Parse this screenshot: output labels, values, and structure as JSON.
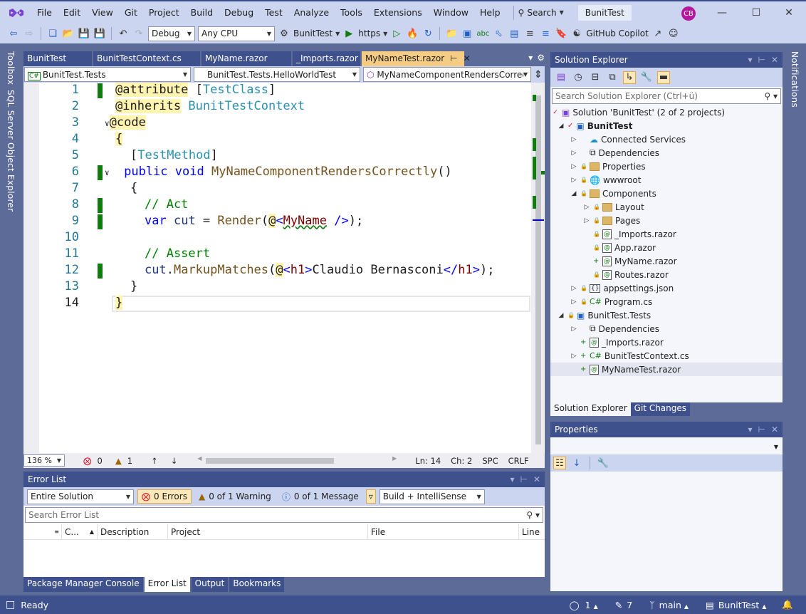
{
  "app": {
    "menu": [
      "File",
      "Edit",
      "View",
      "Git",
      "Project",
      "Build",
      "Debug",
      "Test",
      "Analyze",
      "Tools",
      "Extensions",
      "Window",
      "Help"
    ],
    "search_label": "Search",
    "solution_title": "BunitTest",
    "user_initials": "CB"
  },
  "toolbar": {
    "configuration": "Debug",
    "platform": "Any CPU",
    "startup_project": "BunitTest",
    "launch_profile": "https",
    "copilot_label": "GitHub Copilot"
  },
  "side_tabs": {
    "left": [
      "Toolbox",
      "SQL Server Object Explorer"
    ],
    "right": [
      "Notifications"
    ]
  },
  "doc_tabs": [
    {
      "label": "BunitTest",
      "active": false
    },
    {
      "label": "BunitTestContext.cs",
      "active": false
    },
    {
      "label": "MyName.razor",
      "active": false
    },
    {
      "label": "_Imports.razor",
      "active": false
    },
    {
      "label": "MyNameTest.razor",
      "active": true
    }
  ],
  "nav": {
    "project": "BunitTest.Tests",
    "type": "BunitTest.Tests.HelloWorldTest",
    "member": "MyNameComponentRendersCorrectly"
  },
  "editor": {
    "lines": [
      {
        "n": "1",
        "changed": true
      },
      {
        "n": "2",
        "changed": false
      },
      {
        "n": "3",
        "changed": false
      },
      {
        "n": "4",
        "changed": false
      },
      {
        "n": "5",
        "changed": false
      },
      {
        "n": "6",
        "changed": true
      },
      {
        "n": "7",
        "changed": false
      },
      {
        "n": "8",
        "changed": true
      },
      {
        "n": "9",
        "changed": true
      },
      {
        "n": "10",
        "changed": false
      },
      {
        "n": "11",
        "changed": false
      },
      {
        "n": "12",
        "changed": true
      },
      {
        "n": "13",
        "changed": false
      },
      {
        "n": "14",
        "changed": false
      }
    ],
    "code": {
      "l1a": "@attribute",
      "l1b": "TestClass",
      "l2a": "@inherits",
      "l2b": "BunitTestContext",
      "l3": "@code",
      "l4": "{",
      "l5": "TestMethod",
      "l6a": "public",
      "l6b": "void",
      "l6c": "MyNameComponentRendersCorrectly",
      "l7": "{",
      "l8": "// Act",
      "l9a": "var",
      "l9b": "cut",
      "l9c": "Render",
      "l9d": "MyName",
      "l11": "// Assert",
      "l12a": "cut",
      "l12b": "MarkupMatches",
      "l12c": "h1",
      "l12d": "Claudio Bernasconi",
      "l13": "}",
      "l14": "}"
    }
  },
  "editor_status": {
    "zoom": "136 %",
    "errors": "0",
    "warnings": "1",
    "line": "Ln: 14",
    "col": "Ch: 2",
    "indent": "SPC",
    "eol": "CRLF"
  },
  "error_list": {
    "title": "Error List",
    "scope": "Entire Solution",
    "errors_label": "0 Errors",
    "warnings_label": "0 of 1 Warning",
    "messages_label": "0 of 1 Message",
    "source": "Build + IntelliSense",
    "search_placeholder": "Search Error List",
    "columns": [
      "C...",
      "Description",
      "Project",
      "File",
      "Line"
    ]
  },
  "bottom_tabs": [
    {
      "label": "Package Manager Console",
      "active": false
    },
    {
      "label": "Error List",
      "active": true
    },
    {
      "label": "Output",
      "active": false
    },
    {
      "label": "Bookmarks",
      "active": false
    }
  ],
  "solution_explorer": {
    "title": "Solution Explorer",
    "search_placeholder": "Search Solution Explorer (Ctrl+ü)",
    "items": [
      {
        "label": "Solution 'BunitTest' (2 of 2 projects)",
        "depth": 0,
        "kind": "solution"
      },
      {
        "label": "BunitTest",
        "depth": 1,
        "kind": "project",
        "bold": true
      },
      {
        "label": "Connected Services",
        "depth": 2,
        "kind": "connected"
      },
      {
        "label": "Dependencies",
        "depth": 2,
        "kind": "deps"
      },
      {
        "label": "Properties",
        "depth": 2,
        "kind": "folder"
      },
      {
        "label": "wwwroot",
        "depth": 2,
        "kind": "globe"
      },
      {
        "label": "Components",
        "depth": 2,
        "kind": "folder"
      },
      {
        "label": "Layout",
        "depth": 3,
        "kind": "folder"
      },
      {
        "label": "Pages",
        "depth": 3,
        "kind": "folder"
      },
      {
        "label": "_Imports.razor",
        "depth": 3,
        "kind": "razor"
      },
      {
        "label": "App.razor",
        "depth": 3,
        "kind": "razor"
      },
      {
        "label": "MyName.razor",
        "depth": 3,
        "kind": "razor"
      },
      {
        "label": "Routes.razor",
        "depth": 3,
        "kind": "razor"
      },
      {
        "label": "appsettings.json",
        "depth": 2,
        "kind": "json"
      },
      {
        "label": "Program.cs",
        "depth": 2,
        "kind": "cs"
      },
      {
        "label": "BunitTest.Tests",
        "depth": 1,
        "kind": "project"
      },
      {
        "label": "Dependencies",
        "depth": 2,
        "kind": "deps"
      },
      {
        "label": "_Imports.razor",
        "depth": 2,
        "kind": "razor"
      },
      {
        "label": "BunitTestContext.cs",
        "depth": 2,
        "kind": "cs"
      },
      {
        "label": "MyNameTest.razor",
        "depth": 2,
        "kind": "razor",
        "selected": true
      }
    ],
    "tabs": [
      "Solution Explorer",
      "Git Changes"
    ]
  },
  "properties": {
    "title": "Properties"
  },
  "status_bar": {
    "state": "Ready",
    "commits_up": "1",
    "pending_changes": "7",
    "branch": "main",
    "repo": "BunitTest"
  }
}
